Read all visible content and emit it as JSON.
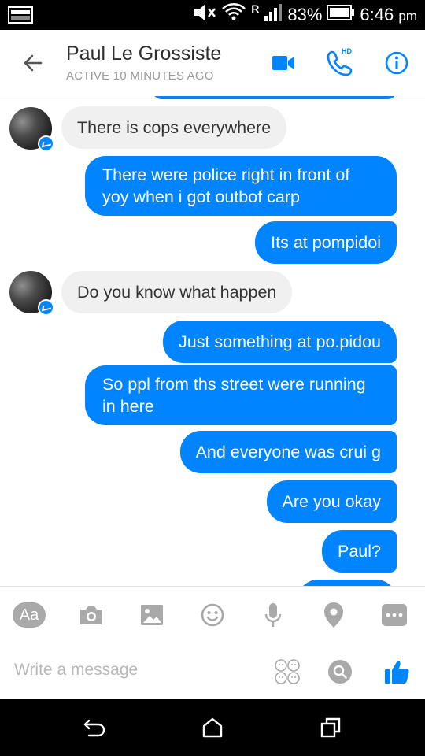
{
  "status_bar": {
    "roaming": "R",
    "battery": "83%",
    "time": "6:46",
    "time_suffix": "pm"
  },
  "header": {
    "contact_name": "Paul Le Grossiste",
    "active_status": "ACTIVE 10 MINUTES AGO",
    "hd_badge": "HD"
  },
  "messages": [
    {
      "from": "contact",
      "text": "There is cops everywhere"
    },
    {
      "from": "me",
      "lines": [
        "There were police right in front of",
        "yoy when i got outbof carp"
      ]
    },
    {
      "from": "me",
      "text": "Its at pompidoi"
    },
    {
      "from": "contact",
      "text": "Do you know what happen"
    },
    {
      "from": "me",
      "text": "Just something at po.pidou"
    },
    {
      "from": "me",
      "lines": [
        "So ppl from ths street were running",
        "in here"
      ]
    },
    {
      "from": "me",
      "text": "And everyone was crui g"
    },
    {
      "from": "me",
      "text": "Are you okay"
    },
    {
      "from": "me",
      "text": "Paul?"
    }
  ],
  "composer": {
    "text_tool_label": "Aa",
    "placeholder": "Write a message"
  },
  "colors": {
    "accent": "#0084ff",
    "incoming_bubble": "#f0f0f0",
    "icon_gray": "#a9a9a9"
  }
}
